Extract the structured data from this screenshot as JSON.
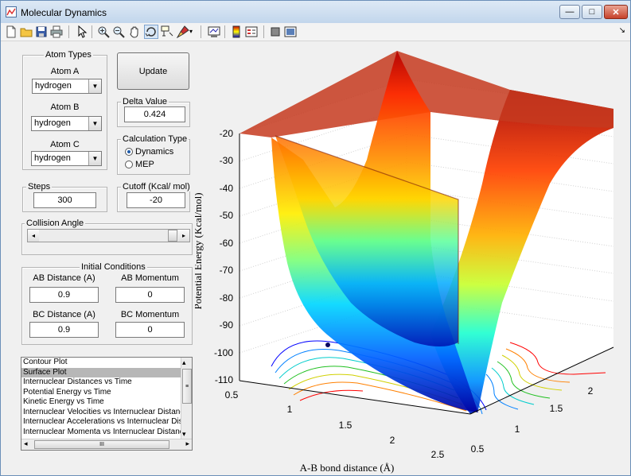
{
  "window": {
    "title": "Molecular Dynamics",
    "minimize": "—",
    "maximize": "□",
    "close": "✕"
  },
  "toolbar": {
    "icons": [
      "new-file-icon",
      "open-folder-icon",
      "save-icon",
      "print-icon",
      "pointer-icon",
      "zoom-in-icon",
      "zoom-out-icon",
      "pan-icon",
      "rotate-icon",
      "data-cursor-icon",
      "brush-icon",
      "link-icon",
      "colorbar-icon",
      "legend-icon",
      "hide-plot-tools-icon",
      "show-plot-tools-icon"
    ],
    "dock": "↘"
  },
  "atom_types": {
    "title": "Atom Types",
    "atom_a_label": "Atom A",
    "atom_a_value": "hydrogen",
    "atom_b_label": "Atom B",
    "atom_b_value": "hydrogen",
    "atom_c_label": "Atom C",
    "atom_c_value": "hydrogen"
  },
  "update_button": "Update",
  "delta": {
    "title": "Delta Value",
    "value": "0.424"
  },
  "calc_type": {
    "title": "Calculation Type",
    "options": [
      "Dynamics",
      "MEP"
    ],
    "selected": "Dynamics"
  },
  "steps": {
    "title": "Steps",
    "value": "300"
  },
  "cutoff": {
    "title": "Cutoff (Kcal/ mol)",
    "value": "-20"
  },
  "collision": {
    "title": "Collision Angle",
    "left_arrow": "◂",
    "right_arrow": "▸"
  },
  "initial_conditions": {
    "title": "Initial Conditions",
    "ab_distance_label": "AB Distance (A)",
    "ab_distance_value": "0.9",
    "ab_momentum_label": "AB Momentum",
    "ab_momentum_value": "0",
    "bc_distance_label": "BC Distance (A)",
    "bc_distance_value": "0.9",
    "bc_momentum_label": "BC Momentum",
    "bc_momentum_value": "0"
  },
  "plot_list": {
    "items": [
      "Contour Plot",
      "Surface Plot",
      "Internuclear Distances vs Time",
      "Potential Energy vs Time",
      "Kinetic Energy vs Time",
      "Internuclear Velocities vs Internuclear Distance",
      "Internuclear Accelerations vs Internuclear Distance",
      "Internuclear Momenta vs Internuclear Distance"
    ],
    "selected": "Surface Plot",
    "scroll_up": "▴",
    "scroll_down": "▾",
    "scroll_left": "◂",
    "scroll_right": "▸",
    "thumb": "≡",
    "hthumb": "III"
  },
  "chart_data": {
    "type": "surface",
    "xlabel": "A-B bond distance (Å)",
    "ylabel": "",
    "zlabel": "Potential Energy (Kcal/mol)",
    "x_ticks": [
      "0.5",
      "1",
      "1.5",
      "2",
      "2.5"
    ],
    "y_ticks": [
      "0.5",
      "1",
      "1.5",
      "2"
    ],
    "z_ticks": [
      "-20",
      "-30",
      "-40",
      "-50",
      "-60",
      "-70",
      "-80",
      "-90",
      "-100",
      "-110"
    ],
    "zlim": [
      -110,
      -20
    ],
    "colormap": "jet",
    "contour_base": true,
    "grid": true
  }
}
